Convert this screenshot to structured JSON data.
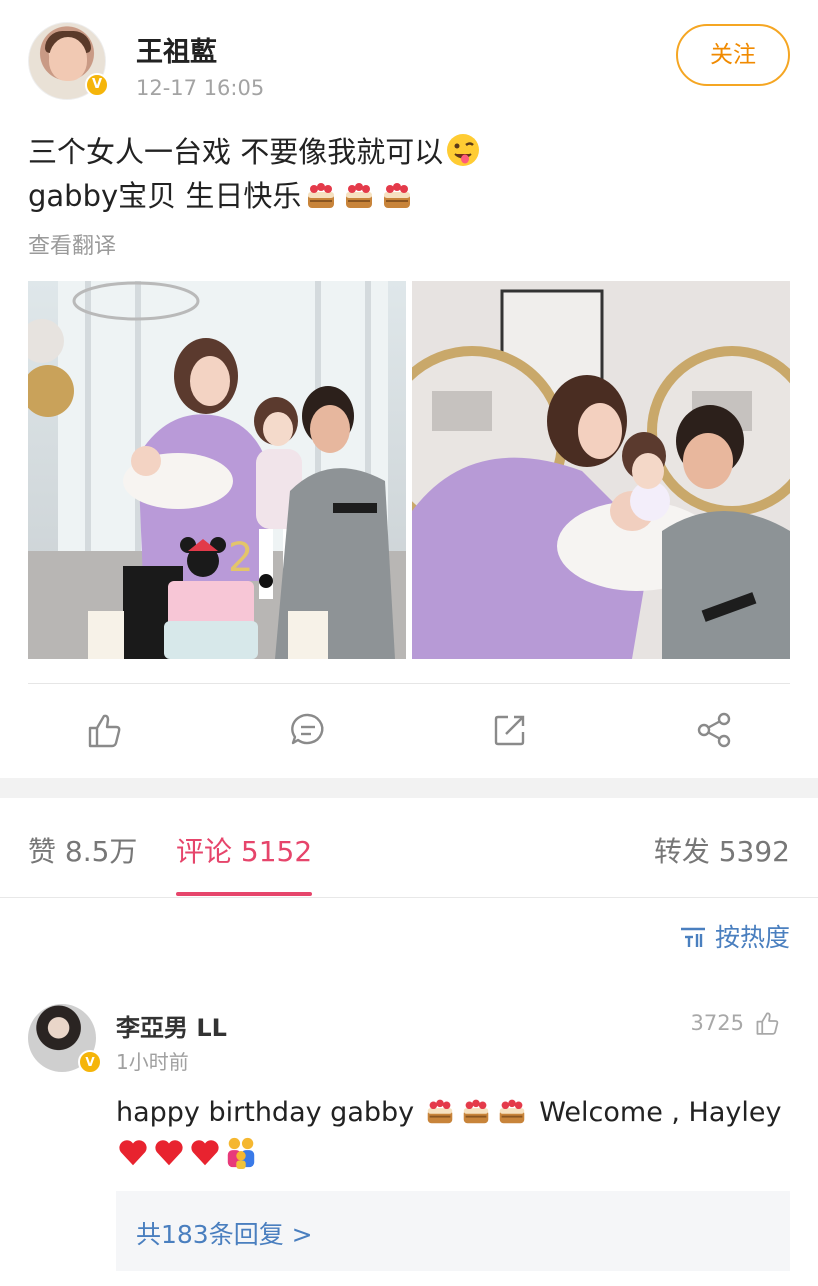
{
  "post": {
    "author": "王祖藍",
    "time": "12-17 16:05",
    "follow_label": "关注",
    "text_line1": "三个女人一台戏 不要像我就可以",
    "text_line2": "gabby宝贝 生日快乐",
    "translate_label": "查看翻译",
    "images": [
      "family-birthday-photo-1",
      "family-kiss-photo-2"
    ]
  },
  "actions": [
    "like-icon",
    "comment-icon",
    "repost-icon",
    "share-icon"
  ],
  "tabs": {
    "likes": "赞 8.5万",
    "comments": "评论 5152",
    "reposts": "转发 5392",
    "active": "comments"
  },
  "sort": {
    "label": "按热度"
  },
  "comment": {
    "author": "李亞男 LL",
    "time": "1小时前",
    "likes": "3725",
    "text_part1": "happy birthday gabby",
    "text_part2": " Welcome , Hayley",
    "replies_label": "共183条回复 >"
  },
  "colors": {
    "accent_pink": "#e6456b",
    "follow_orange": "#f5a623",
    "link_blue": "#4a7fbf",
    "verified_gold": "#f5b50a"
  }
}
